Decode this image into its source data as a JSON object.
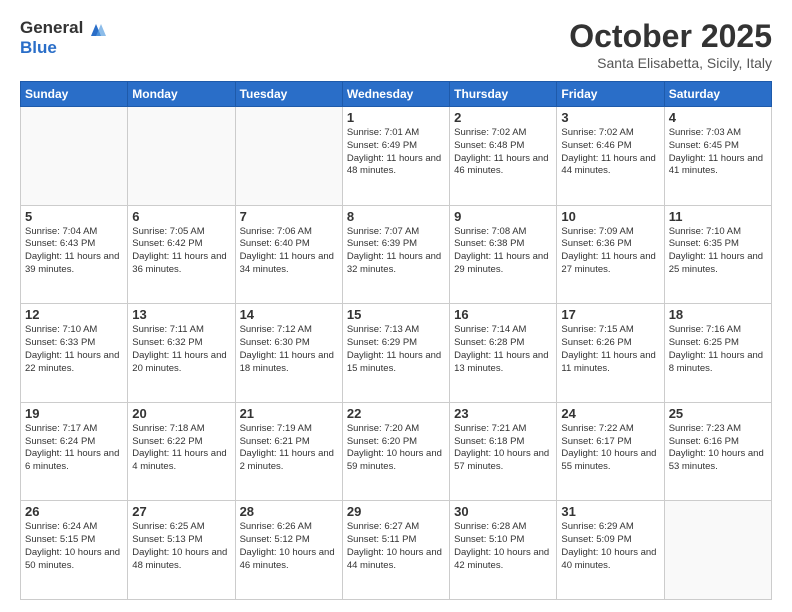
{
  "logo": {
    "general": "General",
    "blue": "Blue"
  },
  "header": {
    "month": "October 2025",
    "location": "Santa Elisabetta, Sicily, Italy"
  },
  "weekdays": [
    "Sunday",
    "Monday",
    "Tuesday",
    "Wednesday",
    "Thursday",
    "Friday",
    "Saturday"
  ],
  "weeks": [
    [
      {
        "day": "",
        "info": ""
      },
      {
        "day": "",
        "info": ""
      },
      {
        "day": "",
        "info": ""
      },
      {
        "day": "1",
        "info": "Sunrise: 7:01 AM\nSunset: 6:49 PM\nDaylight: 11 hours and 48 minutes."
      },
      {
        "day": "2",
        "info": "Sunrise: 7:02 AM\nSunset: 6:48 PM\nDaylight: 11 hours and 46 minutes."
      },
      {
        "day": "3",
        "info": "Sunrise: 7:02 AM\nSunset: 6:46 PM\nDaylight: 11 hours and 44 minutes."
      },
      {
        "day": "4",
        "info": "Sunrise: 7:03 AM\nSunset: 6:45 PM\nDaylight: 11 hours and 41 minutes."
      }
    ],
    [
      {
        "day": "5",
        "info": "Sunrise: 7:04 AM\nSunset: 6:43 PM\nDaylight: 11 hours and 39 minutes."
      },
      {
        "day": "6",
        "info": "Sunrise: 7:05 AM\nSunset: 6:42 PM\nDaylight: 11 hours and 36 minutes."
      },
      {
        "day": "7",
        "info": "Sunrise: 7:06 AM\nSunset: 6:40 PM\nDaylight: 11 hours and 34 minutes."
      },
      {
        "day": "8",
        "info": "Sunrise: 7:07 AM\nSunset: 6:39 PM\nDaylight: 11 hours and 32 minutes."
      },
      {
        "day": "9",
        "info": "Sunrise: 7:08 AM\nSunset: 6:38 PM\nDaylight: 11 hours and 29 minutes."
      },
      {
        "day": "10",
        "info": "Sunrise: 7:09 AM\nSunset: 6:36 PM\nDaylight: 11 hours and 27 minutes."
      },
      {
        "day": "11",
        "info": "Sunrise: 7:10 AM\nSunset: 6:35 PM\nDaylight: 11 hours and 25 minutes."
      }
    ],
    [
      {
        "day": "12",
        "info": "Sunrise: 7:10 AM\nSunset: 6:33 PM\nDaylight: 11 hours and 22 minutes."
      },
      {
        "day": "13",
        "info": "Sunrise: 7:11 AM\nSunset: 6:32 PM\nDaylight: 11 hours and 20 minutes."
      },
      {
        "day": "14",
        "info": "Sunrise: 7:12 AM\nSunset: 6:30 PM\nDaylight: 11 hours and 18 minutes."
      },
      {
        "day": "15",
        "info": "Sunrise: 7:13 AM\nSunset: 6:29 PM\nDaylight: 11 hours and 15 minutes."
      },
      {
        "day": "16",
        "info": "Sunrise: 7:14 AM\nSunset: 6:28 PM\nDaylight: 11 hours and 13 minutes."
      },
      {
        "day": "17",
        "info": "Sunrise: 7:15 AM\nSunset: 6:26 PM\nDaylight: 11 hours and 11 minutes."
      },
      {
        "day": "18",
        "info": "Sunrise: 7:16 AM\nSunset: 6:25 PM\nDaylight: 11 hours and 8 minutes."
      }
    ],
    [
      {
        "day": "19",
        "info": "Sunrise: 7:17 AM\nSunset: 6:24 PM\nDaylight: 11 hours and 6 minutes."
      },
      {
        "day": "20",
        "info": "Sunrise: 7:18 AM\nSunset: 6:22 PM\nDaylight: 11 hours and 4 minutes."
      },
      {
        "day": "21",
        "info": "Sunrise: 7:19 AM\nSunset: 6:21 PM\nDaylight: 11 hours and 2 minutes."
      },
      {
        "day": "22",
        "info": "Sunrise: 7:20 AM\nSunset: 6:20 PM\nDaylight: 10 hours and 59 minutes."
      },
      {
        "day": "23",
        "info": "Sunrise: 7:21 AM\nSunset: 6:18 PM\nDaylight: 10 hours and 57 minutes."
      },
      {
        "day": "24",
        "info": "Sunrise: 7:22 AM\nSunset: 6:17 PM\nDaylight: 10 hours and 55 minutes."
      },
      {
        "day": "25",
        "info": "Sunrise: 7:23 AM\nSunset: 6:16 PM\nDaylight: 10 hours and 53 minutes."
      }
    ],
    [
      {
        "day": "26",
        "info": "Sunrise: 6:24 AM\nSunset: 5:15 PM\nDaylight: 10 hours and 50 minutes."
      },
      {
        "day": "27",
        "info": "Sunrise: 6:25 AM\nSunset: 5:13 PM\nDaylight: 10 hours and 48 minutes."
      },
      {
        "day": "28",
        "info": "Sunrise: 6:26 AM\nSunset: 5:12 PM\nDaylight: 10 hours and 46 minutes."
      },
      {
        "day": "29",
        "info": "Sunrise: 6:27 AM\nSunset: 5:11 PM\nDaylight: 10 hours and 44 minutes."
      },
      {
        "day": "30",
        "info": "Sunrise: 6:28 AM\nSunset: 5:10 PM\nDaylight: 10 hours and 42 minutes."
      },
      {
        "day": "31",
        "info": "Sunrise: 6:29 AM\nSunset: 5:09 PM\nDaylight: 10 hours and 40 minutes."
      },
      {
        "day": "",
        "info": ""
      }
    ]
  ]
}
